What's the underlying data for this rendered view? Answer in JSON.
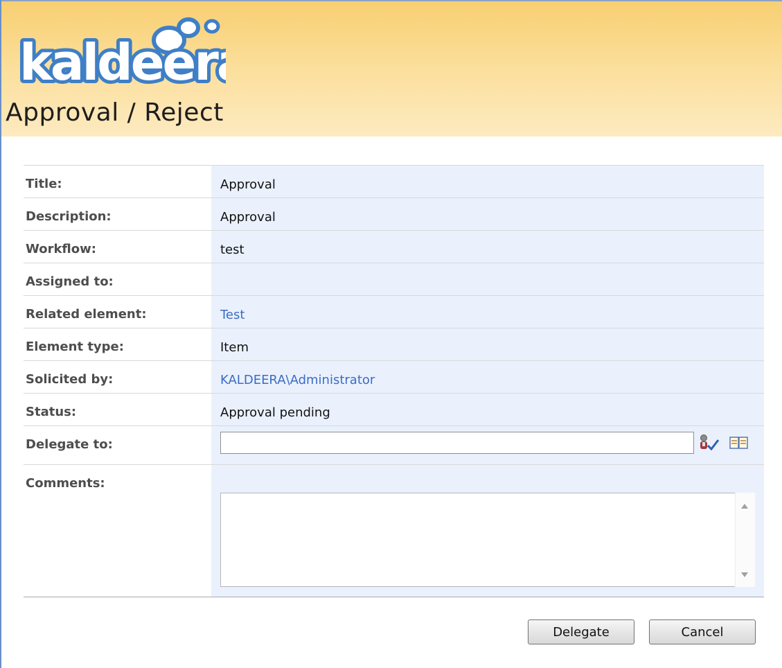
{
  "app": {
    "logo_text": "kaldeera"
  },
  "page": {
    "title": "Approval / Reject"
  },
  "form": {
    "fields": [
      {
        "label": "Title:",
        "value": "Approval"
      },
      {
        "label": "Description:",
        "value": "Approval"
      },
      {
        "label": "Workflow:",
        "value": "test"
      },
      {
        "label": "Assigned to:",
        "value": ""
      },
      {
        "label": "Related element:",
        "value": "Test"
      },
      {
        "label": "Element type:",
        "value": "Item"
      },
      {
        "label": "Solicited by:",
        "value": "KALDEERA\\Administrator"
      },
      {
        "label": "Status:",
        "value": "Approval pending"
      },
      {
        "label": "Delegate to:",
        "value": ""
      },
      {
        "label": "Comments:",
        "value": ""
      }
    ]
  },
  "icons": {
    "check_names": "check-names-icon",
    "browse": "address-book-icon"
  },
  "buttons": {
    "delegate": "Delegate",
    "cancel": "Cancel"
  },
  "colors": {
    "header_top": "#f8cf72",
    "header_bottom": "#fdeac0",
    "value_bg": "#eaf1fd",
    "link": "#3b6cc4",
    "logo": "#3f7fc6"
  }
}
